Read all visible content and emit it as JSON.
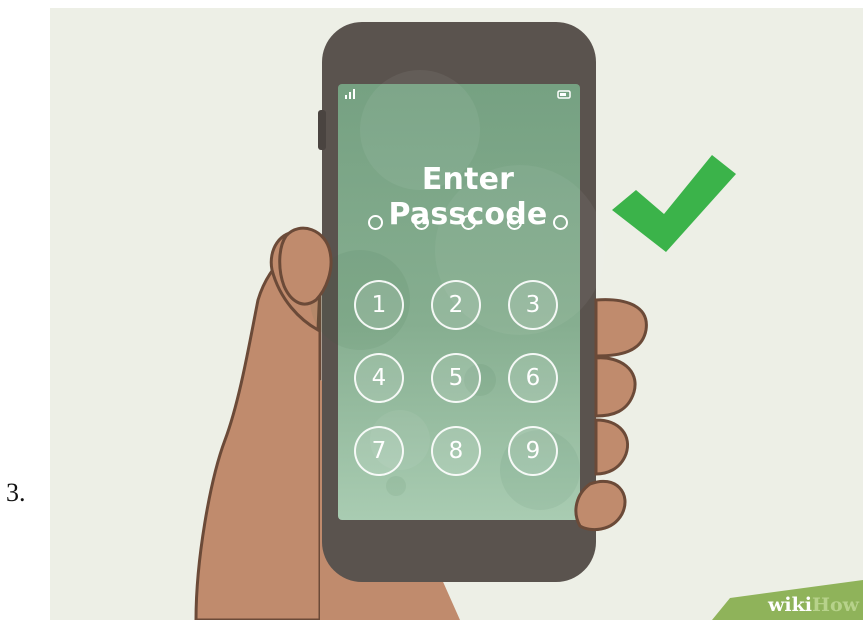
{
  "step": {
    "number": "3."
  },
  "phone": {
    "status_bar": {
      "signal_icon": "signal-bars-icon",
      "battery_icon": "battery-icon"
    },
    "lock_screen": {
      "title": "Enter Passcode",
      "passcode_length": 5,
      "keypad": [
        "1",
        "2",
        "3",
        "4",
        "5",
        "6",
        "7",
        "8",
        "9"
      ]
    }
  },
  "checkmark": {
    "icon": "checkmark-icon",
    "color": "#3bb34a"
  },
  "watermark": {
    "part1": "wiki",
    "part2": "How",
    "color": "#8fb35a"
  },
  "colors": {
    "background": "#edefe6",
    "phone_body": "#5a534e",
    "screen_green": "#7ea889",
    "skin": "#c08b6d",
    "skin_outline": "#6b4a38"
  }
}
